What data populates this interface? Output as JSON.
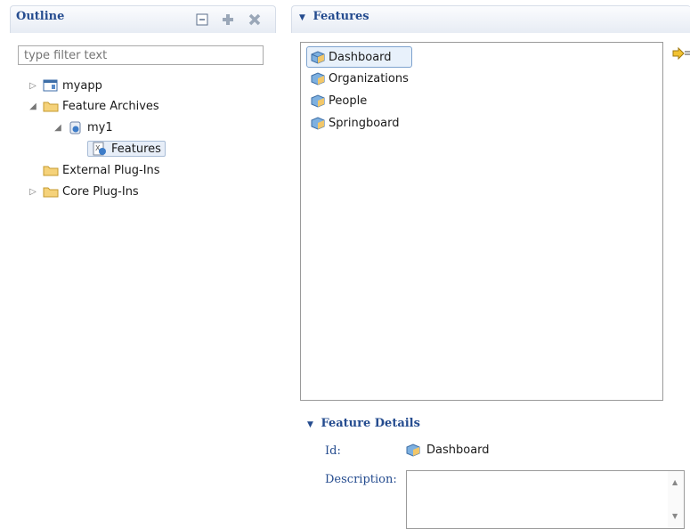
{
  "outline": {
    "title": "Outline",
    "filter_placeholder": "type filter text",
    "toolbar": [
      "collapse-all-icon",
      "add-icon",
      "remove-icon"
    ],
    "tree": [
      {
        "label": "myapp",
        "expanded": false,
        "icon": "application-icon"
      },
      {
        "label": "Feature Archives",
        "expanded": true,
        "icon": "folder-icon"
      },
      {
        "label": "my1",
        "expanded": true,
        "icon": "archive-icon"
      },
      {
        "label": "Features",
        "selected": true,
        "icon": "features-file-icon"
      },
      {
        "label": "External Plug-Ins",
        "icon": "folder-icon"
      },
      {
        "label": "Core Plug-Ins",
        "expanded": false,
        "icon": "folder-icon"
      }
    ]
  },
  "features": {
    "title": "Features",
    "items": [
      "Dashboard",
      "Organizations",
      "People",
      "Springboard"
    ],
    "selected": "Dashboard",
    "side_action_icon": "add-to-list-icon"
  },
  "details": {
    "title": "Feature Details",
    "id_label": "Id:",
    "id_value": "Dashboard",
    "description_label": "Description:",
    "description_value": ""
  },
  "colors": {
    "header_text": "#254c8f",
    "selection_border": "#7da2ce"
  }
}
